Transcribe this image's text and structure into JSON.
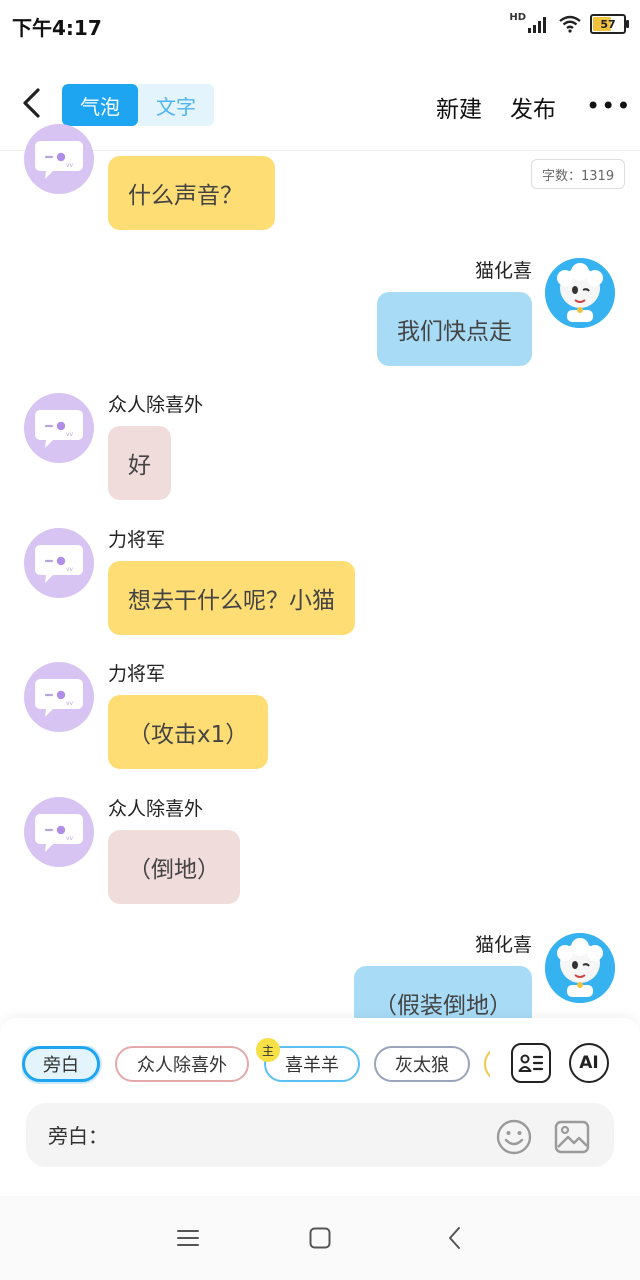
{
  "status_bar": {
    "time": "下午4:17",
    "network": "HD",
    "battery_level": "57"
  },
  "header": {
    "back_icon": "chevron-left-icon",
    "tabs": [
      {
        "label": "气泡",
        "active": true
      },
      {
        "label": "文字",
        "active": false
      }
    ],
    "new_label": "新建",
    "publish_label": "发布",
    "more_label": "•••"
  },
  "word_count": "字数：1319",
  "messages": [
    {
      "speaker": "",
      "text": "什么声音？",
      "side": "left",
      "color": "#fedd74"
    },
    {
      "speaker": "猫化喜",
      "text": "我们快点走",
      "side": "right",
      "color": "#a8dcf6"
    },
    {
      "speaker": "众人除喜外",
      "text": "好",
      "side": "left",
      "color": "#f1dcdc"
    },
    {
      "speaker": "力将军",
      "text": "想去干什么呢？小猫",
      "side": "left",
      "color": "#fedd74"
    },
    {
      "speaker": "力将军",
      "text": "（攻击x1）",
      "side": "left",
      "color": "#fedd74"
    },
    {
      "speaker": "众人除喜外",
      "text": "（倒地）",
      "side": "left",
      "color": "#f1dcdc"
    },
    {
      "speaker": "猫化喜",
      "text": "（假装倒地）",
      "side": "right",
      "color": "#a8dcf6"
    }
  ],
  "roles": [
    {
      "label": "旁白",
      "selected": true
    },
    {
      "label": "众人除喜外",
      "selected": false
    },
    {
      "label": "喜羊羊",
      "selected": false,
      "badge": "主"
    },
    {
      "label": "灰太狼",
      "selected": false
    }
  ],
  "tools": {
    "character_card_icon": "id-card-icon",
    "ai_label": "AI"
  },
  "input": {
    "placeholder": "旁白：",
    "value": ""
  },
  "nav": {
    "menu_icon": "menu-icon",
    "home_icon": "square-icon",
    "back_icon": "back-triangle-icon"
  },
  "colors": {
    "accent": "#1ea5f2",
    "bubble_yellow": "#fedd74",
    "bubble_pink": "#f1dcdc",
    "bubble_blue": "#a8dcf6",
    "avatar_purple": "#d7c4f3"
  }
}
